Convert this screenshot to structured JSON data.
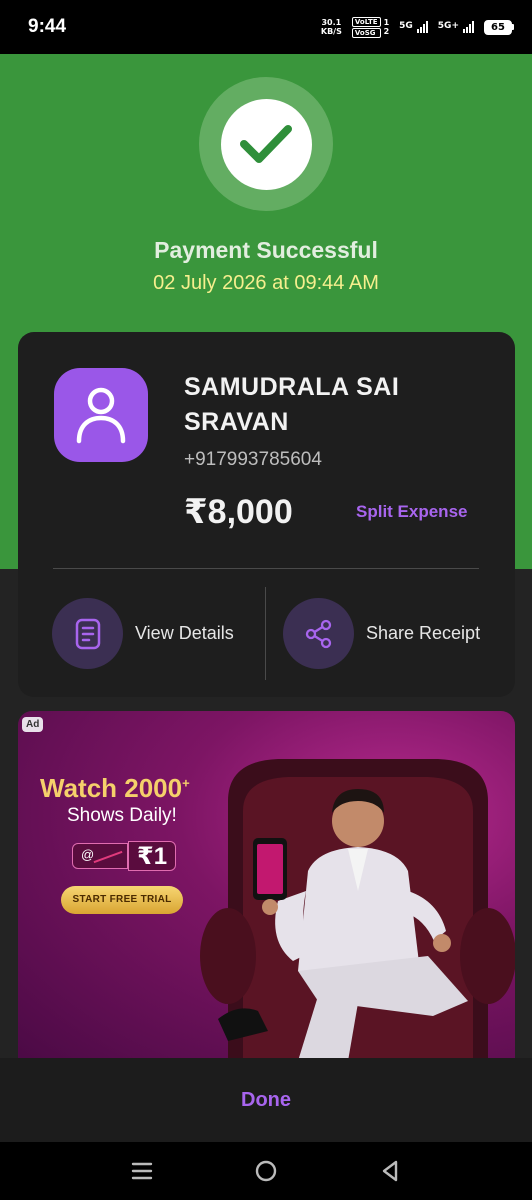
{
  "status_bar": {
    "time": "9:44",
    "net_speed_value": "30.1",
    "net_speed_unit": "KB/S",
    "volte_1": "VoLTE",
    "volte_2": "VoSG",
    "sim_1": "1",
    "sim_2": "2",
    "signal_1_label": "5G",
    "signal_2_label": "5G+",
    "battery": "65"
  },
  "payment": {
    "title": "Payment Successful",
    "date": "02 July 2026 at 09:44 AM",
    "status_color": "#3a963c"
  },
  "payee": {
    "name": "SAMUDRALA SAI SRAVAN",
    "phone": "+917993785604",
    "amount": "₹8,000",
    "split_label": "Split Expense",
    "avatar_color": "#9a57e8"
  },
  "actions": {
    "view_details": "View Details",
    "share_receipt": "Share Receipt"
  },
  "ad": {
    "badge": "Ad",
    "headline": "Watch 2000",
    "headline_sup": "+",
    "sub": "Shows Daily!",
    "old_price": "@",
    "new_price": "₹1",
    "cta": "START FREE TRIAL"
  },
  "footer": {
    "done_label": "Done",
    "accent_color": "#a865ee"
  },
  "nav": {
    "icons": [
      "menu-icon",
      "home-icon",
      "back-icon"
    ]
  }
}
